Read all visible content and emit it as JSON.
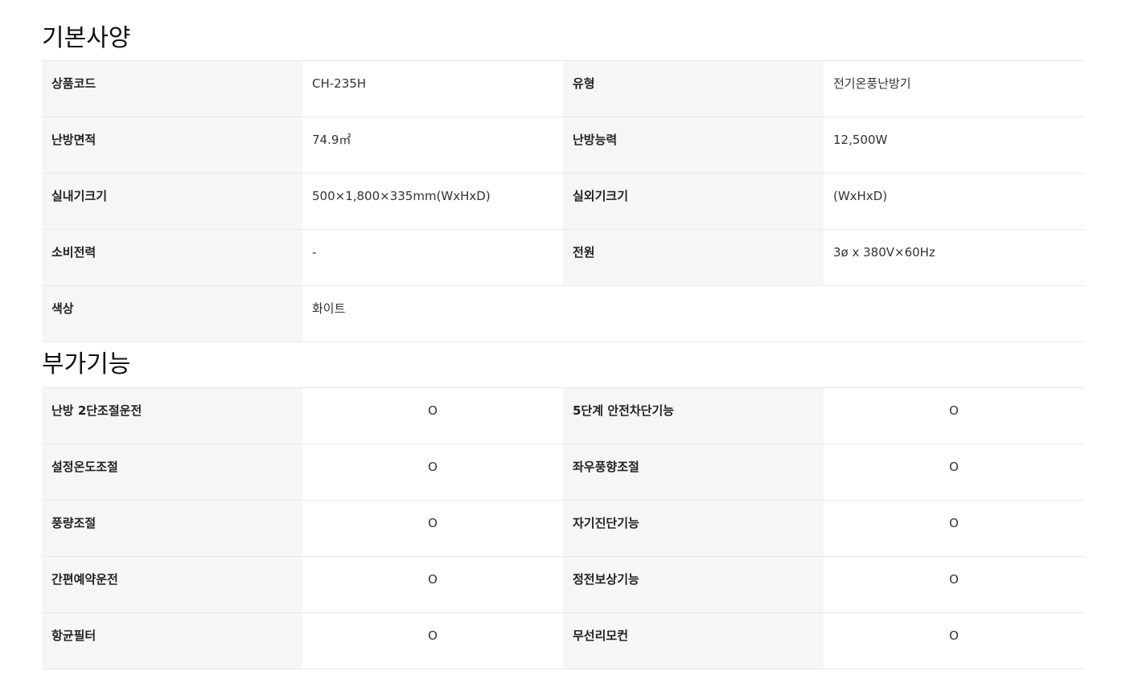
{
  "basic_spec": {
    "title": "기본사양",
    "rows": [
      [
        {
          "label": "상품코드",
          "value": "CH-235H"
        },
        {
          "label": "유형",
          "value": "전기온풍난방기"
        }
      ],
      [
        {
          "label": "난방면적",
          "value": "74.9㎡"
        },
        {
          "label": "난방능력",
          "value": "12,500W"
        }
      ],
      [
        {
          "label": "실내기크기",
          "value": "500×1,800×335mm(WxHxD)"
        },
        {
          "label": "실외기크기",
          "value": "(WxHxD)"
        }
      ],
      [
        {
          "label": "소비전력",
          "value": "-"
        },
        {
          "label": "전원",
          "value": "3ø x 380V×60Hz"
        }
      ],
      [
        {
          "label": "색상",
          "value": "화이트"
        }
      ]
    ]
  },
  "extra_features": {
    "title": "부가기능",
    "rows": [
      [
        {
          "label": "난방 2단조절운전",
          "value": "O"
        },
        {
          "label": "5단계 안전차단기능",
          "value": "O"
        }
      ],
      [
        {
          "label": "설정온도조절",
          "value": "O"
        },
        {
          "label": "좌우풍향조절",
          "value": "O"
        }
      ],
      [
        {
          "label": "풍량조절",
          "value": "O"
        },
        {
          "label": "자기진단기능",
          "value": "O"
        }
      ],
      [
        {
          "label": "간편예약운전",
          "value": "O"
        },
        {
          "label": "정전보상기능",
          "value": "O"
        }
      ],
      [
        {
          "label": "항균필터",
          "value": "O"
        },
        {
          "label": "무선리모컨",
          "value": "O"
        }
      ]
    ]
  }
}
